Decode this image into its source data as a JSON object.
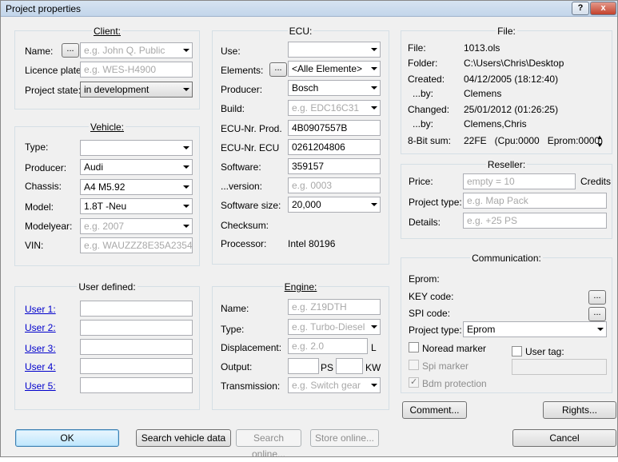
{
  "window": {
    "title": "Project properties",
    "help": "?",
    "close": "x"
  },
  "client": {
    "title": "Client:",
    "name_label": "Name:",
    "name_btn": "...",
    "name_ph": "e.g. John Q. Public",
    "plate_label": "Licence plate:",
    "plate_ph": "e.g. WES-H4900",
    "state_label": "Project state:",
    "state_value": "in development"
  },
  "vehicle": {
    "title": "Vehicle:",
    "type_label": "Type:",
    "type_value": "",
    "producer_label": "Producer:",
    "producer_value": "Audi",
    "chassis_label": "Chassis:",
    "chassis_value": "A4 M5.92",
    "model_label": "Model:",
    "model_value": "1.8T -Neu",
    "modelyear_label": "Modelyear:",
    "modelyear_ph": "e.g. 2007",
    "vin_label": "VIN:",
    "vin_ph": "e.g. WAUZZZ8E35A23542"
  },
  "user_defined": {
    "title": "User defined:",
    "items": [
      "User 1:",
      "User 2:",
      "User 3:",
      "User 4:",
      "User 5:"
    ]
  },
  "ecu": {
    "title": "ECU:",
    "use_label": "Use:",
    "use_value": "",
    "elements_label": "Elements:",
    "elements_btn": "...",
    "elements_value": "<Alle Elemente>",
    "producer_label": "Producer:",
    "producer_value": "Bosch",
    "build_label": "Build:",
    "build_ph": "e.g. EDC16C31",
    "prod_label": "ECU-Nr. Prod.",
    "prod_value": "4B0907557B",
    "ecu_label": "ECU-Nr. ECU",
    "ecu_value": "0261204806",
    "software_label": "Software:",
    "software_value": "359157",
    "version_label": "...version:",
    "version_ph": "e.g. 0003",
    "size_label": "Software size:",
    "size_value": "20,000",
    "checksum_label": "Checksum:",
    "processor_label": "Processor:",
    "processor_value": "Intel 80196"
  },
  "engine": {
    "title": "Engine:",
    "name_label": "Name:",
    "name_ph": "e.g. Z19DTH",
    "type_label": "Type:",
    "type_ph": "e.g. Turbo-Diesel",
    "displacement_label": "Displacement:",
    "displacement_ph": "e.g. 2.0",
    "displacement_unit": "L",
    "output_label": "Output:",
    "ps_unit": "PS",
    "kw_unit": "KW",
    "transmission_label": "Transmission:",
    "transmission_ph": "e.g. Switch gear"
  },
  "file": {
    "title": "File:",
    "file_label": "File:",
    "file_value": "1013.ols",
    "folder_label": "Folder:",
    "folder_value": "C:\\Users\\Chris\\Desktop",
    "created_label": "Created:",
    "created_value": "04/12/2005 (18:12:40)",
    "created_by_label": "...by:",
    "created_by_value": "Clemens",
    "changed_label": "Changed:",
    "changed_value": "25/01/2012 (01:26:25)",
    "changed_by_label": "...by:",
    "changed_by_value": "Clemens,Chris",
    "sum_label": "8-Bit sum:",
    "sum_value": "22FE   (Cpu:0000   Eprom:0000)"
  },
  "reseller": {
    "title": "Reseller:",
    "price_label": "Price:",
    "price_ph": "empty = 10",
    "credits": "Credits",
    "ptype_label": "Project type:",
    "ptype_ph": "e.g. Map Pack",
    "details_label": "Details:",
    "details_ph": "e.g. +25 PS"
  },
  "communication": {
    "title": "Communication:",
    "eprom_label": "Eprom:",
    "key_label": "KEY code:",
    "key_btn": "...",
    "spi_label": "SPI code:",
    "spi_btn": "...",
    "ptype_label": "Project type:",
    "ptype_value": "Eprom",
    "noread_label": "Noread marker",
    "spi_marker_label": "Spi marker",
    "bdm_label": "Bdm protection",
    "user_tag_label": "User tag:"
  },
  "buttons": {
    "comment": "Comment...",
    "rights": "Rights...",
    "ok": "OK",
    "search_vehicle": "Search vehicle data",
    "search_online": "Search online...",
    "store_online": "Store online...",
    "cancel": "Cancel"
  }
}
